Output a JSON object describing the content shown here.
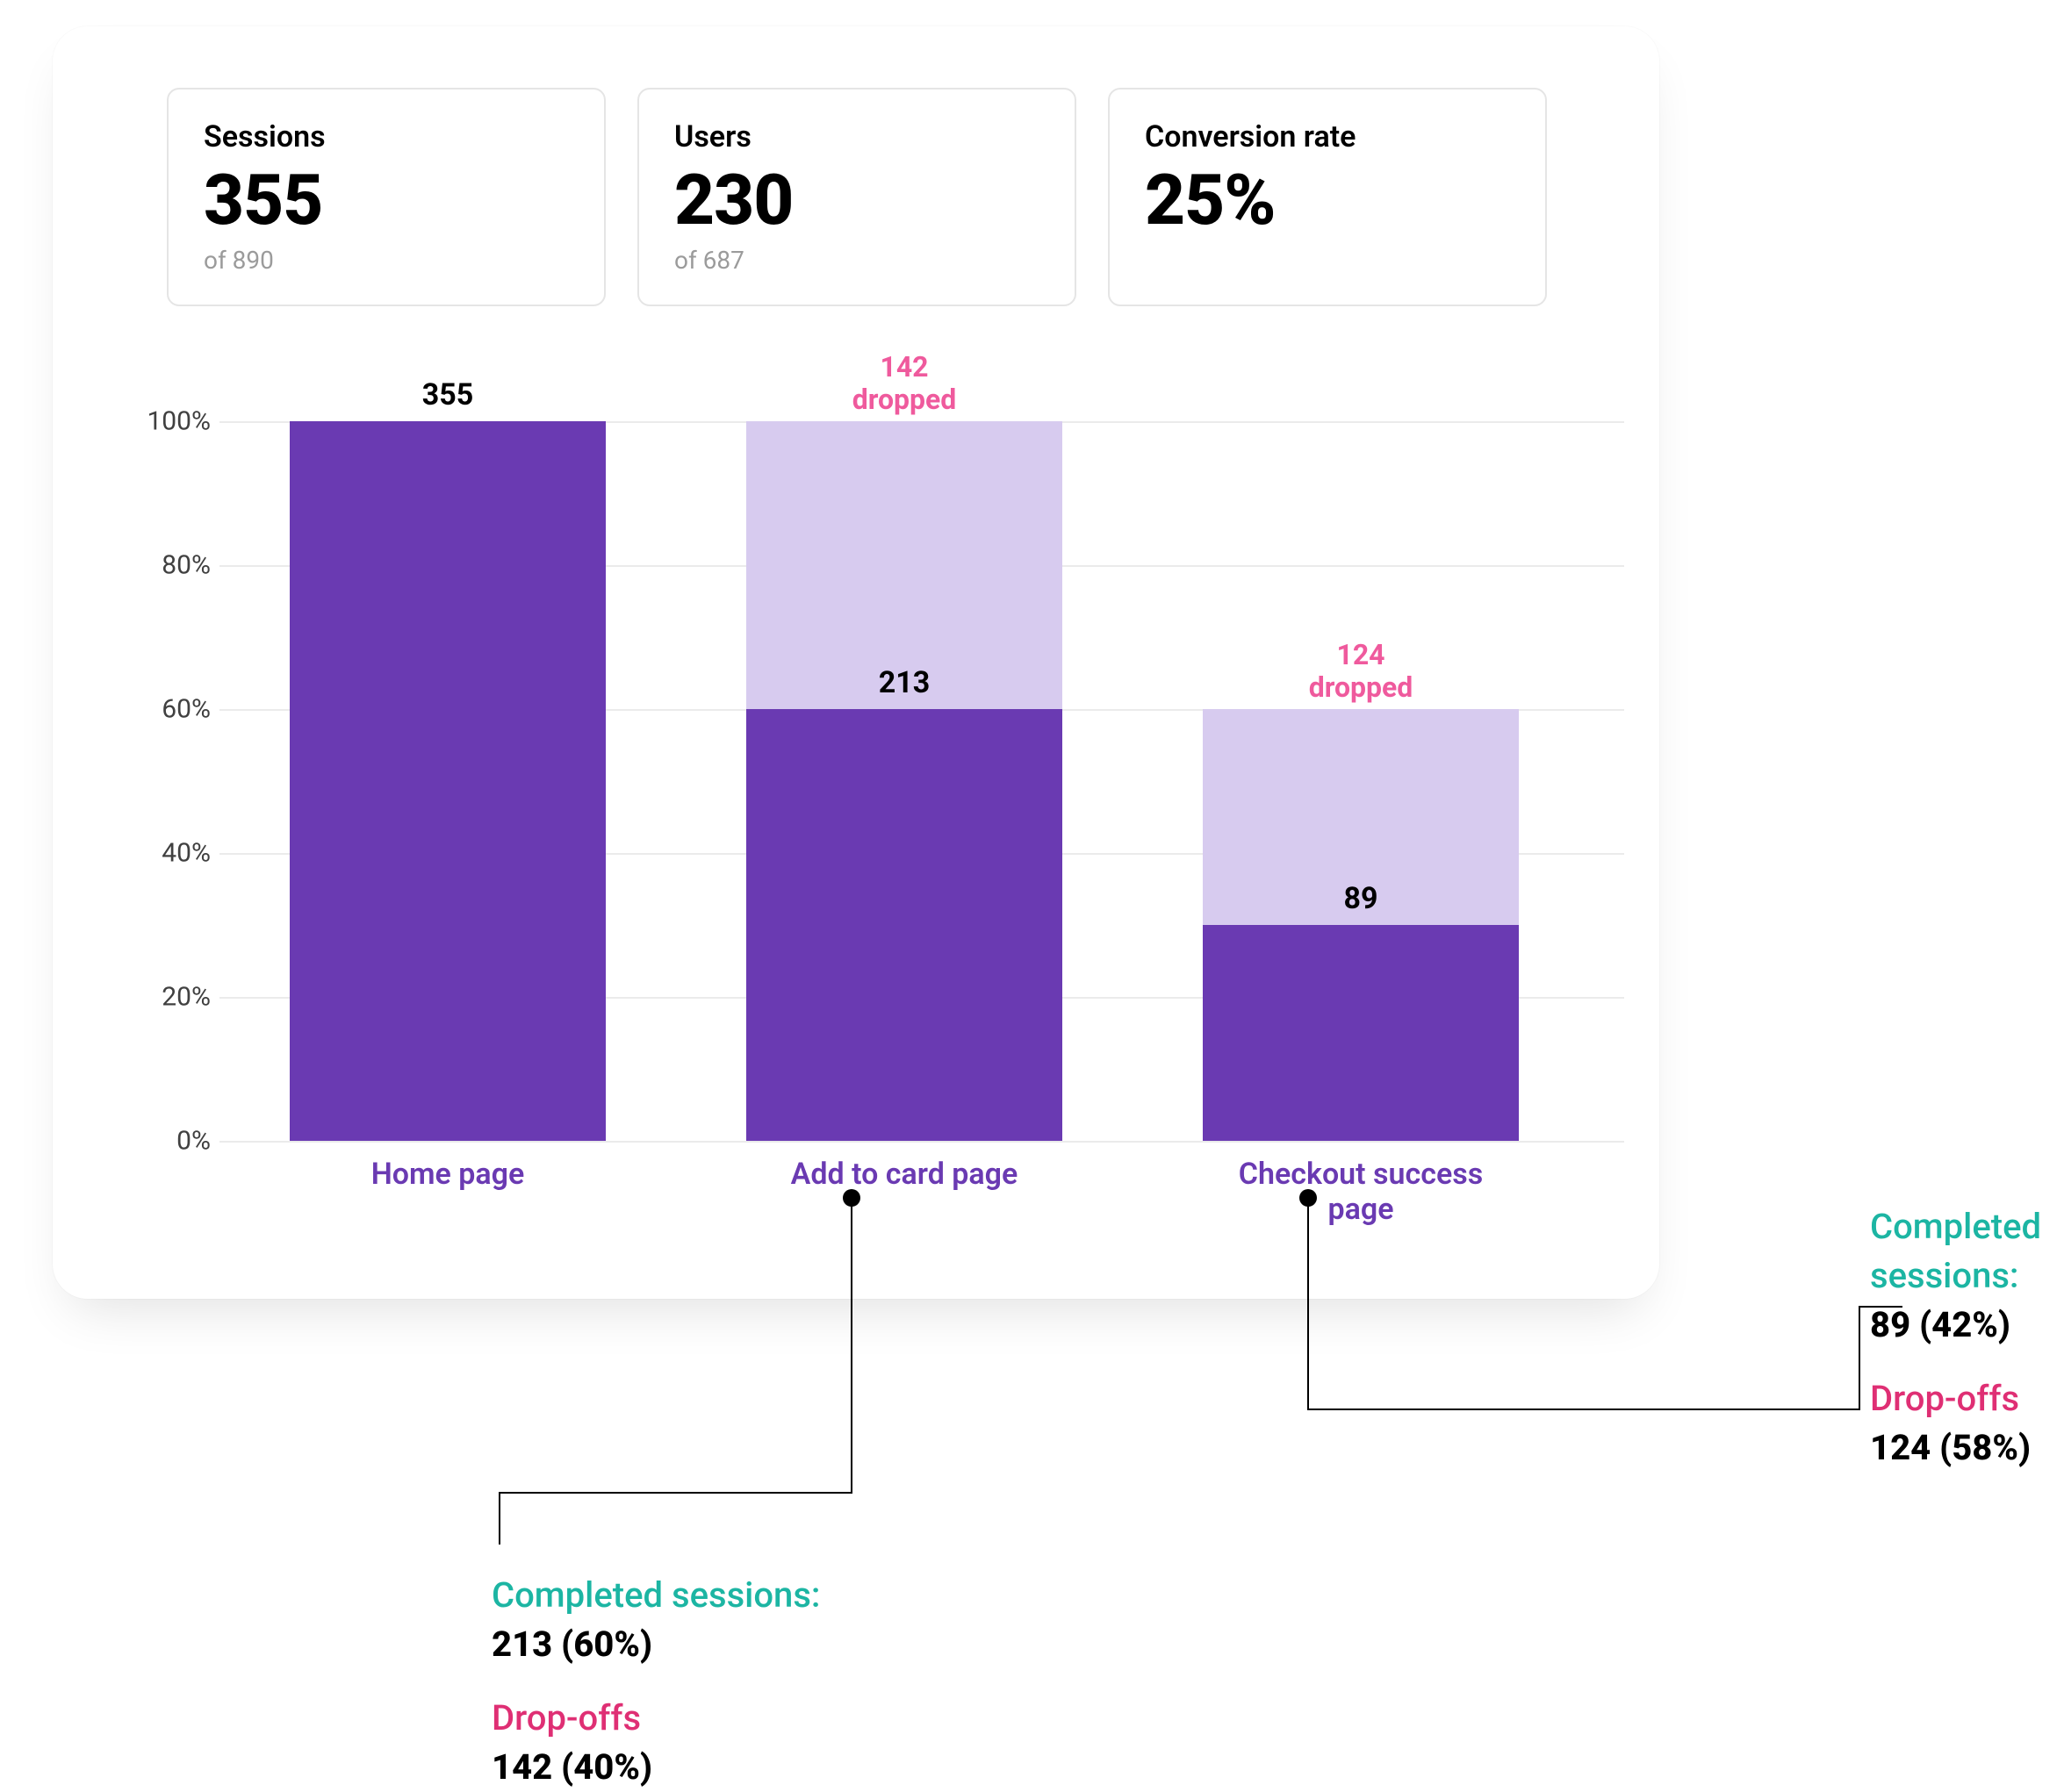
{
  "summary": {
    "sessions": {
      "label": "Sessions",
      "value": "355",
      "sub": "of 890"
    },
    "users": {
      "label": "Users",
      "value": "230",
      "sub": "of 687"
    },
    "conversion": {
      "label": "Conversion rate",
      "value": "25%"
    }
  },
  "chart_data": {
    "type": "bar",
    "ylabel": "",
    "ylim": [
      0,
      100
    ],
    "y_ticks": [
      "0%",
      "20%",
      "40%",
      "60%",
      "80%",
      "100%"
    ],
    "categories": [
      "Home page",
      "Add to card page",
      "Checkout success page"
    ],
    "series": [
      {
        "name": "pass_through_pct",
        "values": [
          100,
          60,
          30
        ]
      },
      {
        "name": "dropped_pct",
        "values": [
          0,
          40,
          30
        ]
      }
    ],
    "pass_counts": [
      355,
      213,
      89
    ],
    "dropped_counts": [
      null,
      142,
      124
    ],
    "bar_top_labels": [
      "355",
      null,
      null
    ],
    "dropped_labels": [
      null,
      "142\ndropped",
      "124\ndropped"
    ],
    "pass_labels": [
      null,
      "213",
      "89"
    ]
  },
  "callouts": {
    "left": {
      "completed_label": "Completed sessions:",
      "completed_value": "213 (60%)",
      "dropoffs_label": "Drop-offs",
      "dropoffs_value": "142 (40%)"
    },
    "right": {
      "completed_label": "Completed sessions:",
      "completed_value": "89 (42%)",
      "dropoffs_label": "Drop-offs",
      "dropoffs_value": "124 (58%)"
    }
  },
  "colors": {
    "bar_solid": "#6a3ab2",
    "bar_light": "#d7cbef",
    "drop_text": "#ef5a9d",
    "x_label": "#6a3ab2",
    "teal": "#1cb5a3",
    "pink": "#df2f74"
  }
}
